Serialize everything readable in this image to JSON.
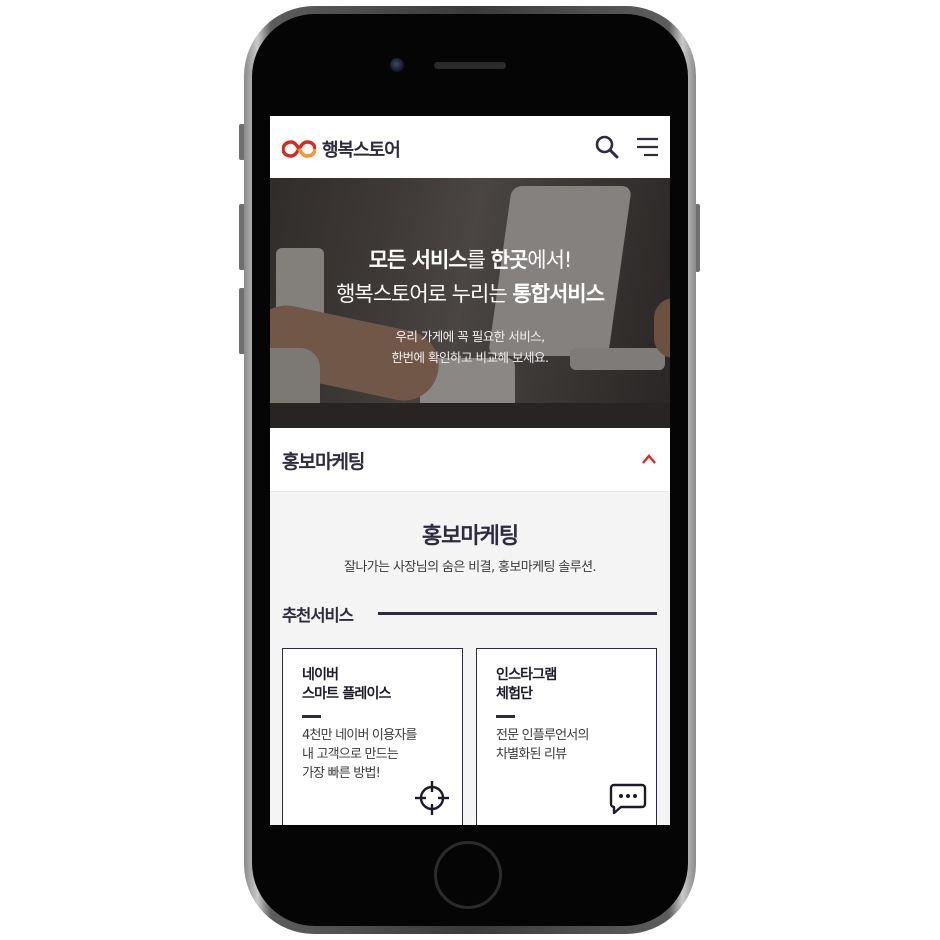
{
  "app": {
    "brand": "행복스토어",
    "brand_colors": {
      "primary": "#e2261b",
      "accent": "#f19a35",
      "text": "#2e2b3f"
    }
  },
  "header": {
    "search_icon": "search-icon",
    "menu_icon": "hamburger-menu-icon"
  },
  "hero": {
    "line1": {
      "b1": "모든 서비스",
      "t1": "를 ",
      "b2": "한곳",
      "t2": "에서!"
    },
    "line2": {
      "t1": "행복스토어로 누리는 ",
      "b1": "통합서비스"
    },
    "sub1": "우리 가게에 꼭 필요한 서비스,",
    "sub2": "한번에 확인하고 비교해 보세요."
  },
  "accordion": {
    "title": "홍보마케팅",
    "state": "expanded",
    "icon": "chevron-up-icon"
  },
  "section": {
    "title": "홍보마케팅",
    "description": "잘나가는 사장님의 숨은 비결, 홍보마케팅 솔루션.",
    "recommended_label": "추천서비스"
  },
  "cards": [
    {
      "title": "네이버\n스마트 플레이스",
      "description": "4천만 네이버 이용자를\n내 고객으로 만드는\n가장 빠른 방법!",
      "icon": "crosshair-icon"
    },
    {
      "title": "인스타그램\n체험단",
      "description": "전문 인플루언서의\n차별화된 리뷰",
      "icon": "chat-bubble-icon"
    }
  ]
}
